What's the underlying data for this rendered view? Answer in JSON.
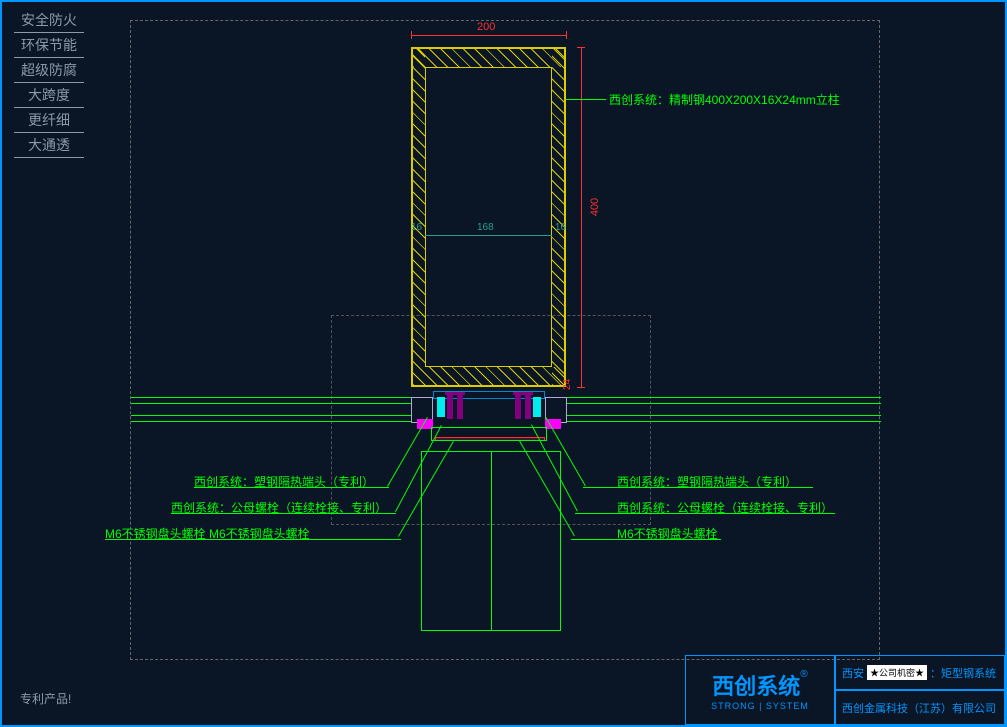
{
  "sidebar": {
    "items": [
      "安全防火",
      "环保节能",
      "超级防腐",
      "大跨度",
      "更纤细",
      "大通透"
    ]
  },
  "patent_note": "专利产品!",
  "dimensions": {
    "width": "200",
    "height": "400",
    "inner": "168",
    "wall_l": "16",
    "wall_r": "16",
    "bottom": "24"
  },
  "annotations": {
    "column": "西创系统：精制钢400X200X16X24mm立柱",
    "left": [
      "西创系统：塑钢隔热端头（专利）",
      "西创系统：公母螺栓（连续栓接、专利）",
      "M6不锈钢盘头螺栓 M6不锈钢盘头螺栓"
    ],
    "right": [
      "西创系统：塑钢隔热端头（专利）",
      "西创系统：公母螺栓（连续栓接、专利）",
      "M6不锈钢盘头螺栓"
    ]
  },
  "title_block": {
    "logo": "西创系统",
    "logo_reg": "®",
    "logo_sub": "STRONG | SYSTEM",
    "project_prefix": "西安",
    "stamp": "★公司机密★",
    "project_suffix": "：矩型钢系统",
    "company": "西创金属科技（江苏）有限公司"
  }
}
